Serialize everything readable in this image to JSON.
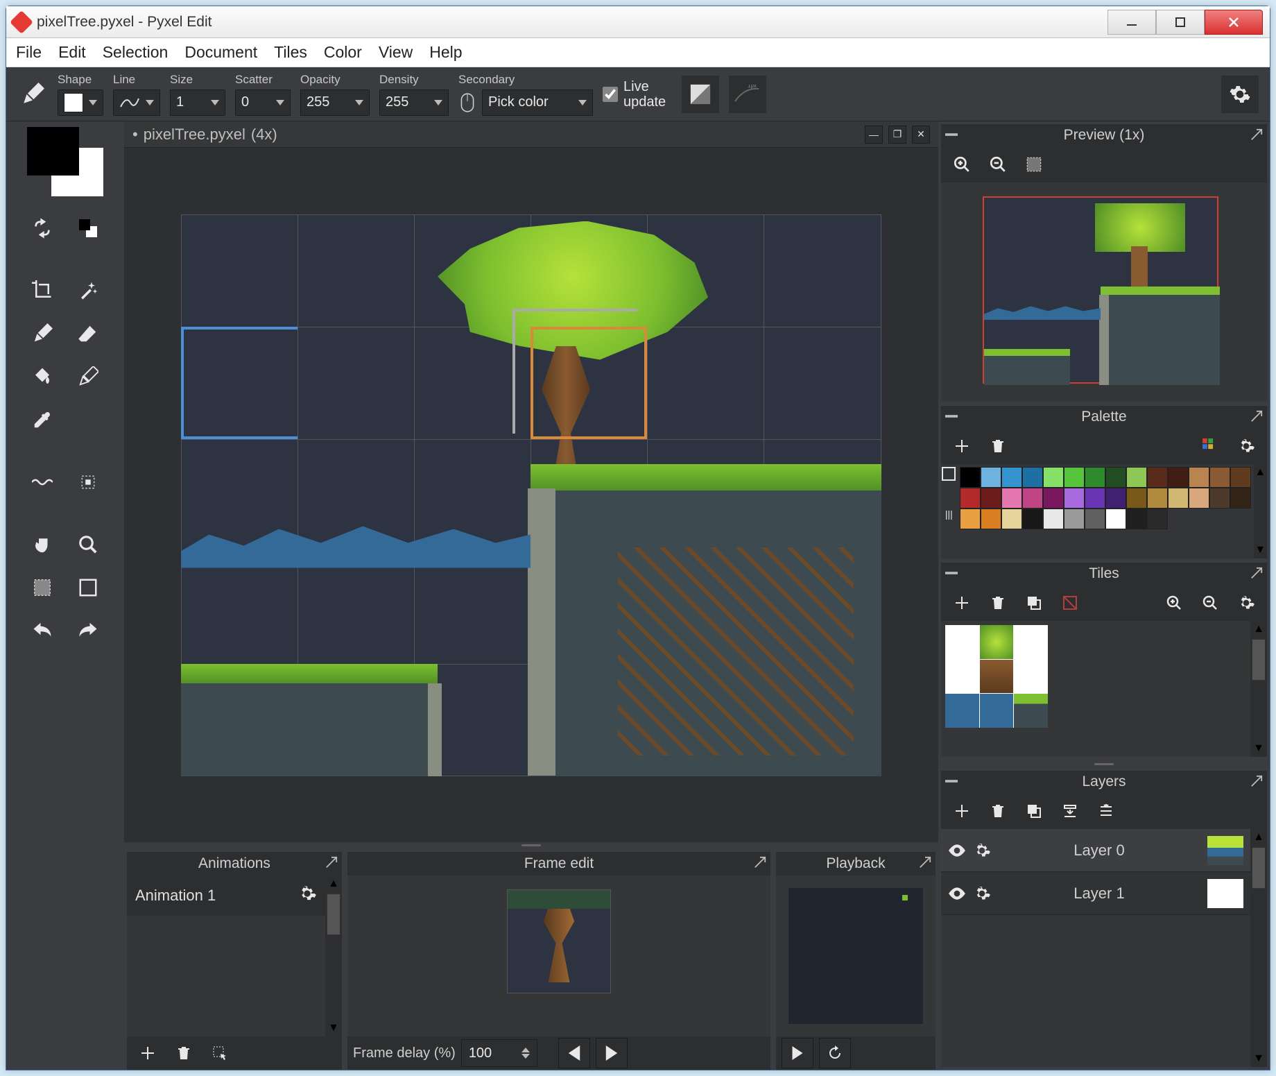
{
  "window": {
    "title": "pixelTree.pyxel - Pyxel Edit"
  },
  "menu": {
    "items": [
      "File",
      "Edit",
      "Selection",
      "Document",
      "Tiles",
      "Color",
      "View",
      "Help"
    ]
  },
  "toolbar": {
    "shape_label": "Shape",
    "line_label": "Line",
    "size_label": "Size",
    "size": "1",
    "scatter_label": "Scatter",
    "scatter": "0",
    "opacity_label": "Opacity",
    "opacity": "255",
    "density_label": "Density",
    "density": "255",
    "secondary_label": "Secondary",
    "secondary_value": "Pick color",
    "liveupdate_label": "Live update"
  },
  "document": {
    "name": "pixelTree.pyxel",
    "zoom": "(4x)",
    "modified": true
  },
  "panels": {
    "preview": {
      "title": "Preview (1x)"
    },
    "palette": {
      "title": "Palette",
      "colors": [
        "#000000",
        "#6eb3e0",
        "#3594cf",
        "#1f6fa5",
        "#84e268",
        "#57c43e",
        "#2e8a2c",
        "#224d22",
        "#8fc756",
        "#5a2a1a",
        "#401e14",
        "#b9844f",
        "#8a5a34",
        "#5f3b20",
        "#b42a2a",
        "#6e1b1b",
        "#e477b0",
        "#c04585",
        "#7a1860",
        "#a86adf",
        "#6a35b5",
        "#402070",
        "#79591a",
        "#b08a3d",
        "#d2b872",
        "#d9a77d",
        "#4d3a2a",
        "#332418",
        "#e8a043",
        "#d97f22",
        "#e6d49a",
        "#181818",
        "#e8e8e8",
        "#9a9a9a",
        "#606060",
        "#ffffff",
        "#1f1f1f",
        "#2a2a2a"
      ]
    },
    "tiles": {
      "title": "Tiles"
    },
    "layers": {
      "title": "Layers",
      "rows": [
        {
          "name": "Layer 0"
        },
        {
          "name": "Layer 1"
        }
      ]
    },
    "animations": {
      "title": "Animations",
      "items": [
        {
          "name": "Animation 1"
        }
      ]
    },
    "frameedit": {
      "title": "Frame edit",
      "delay_label": "Frame delay (%)",
      "delay_value": "100"
    },
    "playback": {
      "title": "Playback"
    }
  }
}
